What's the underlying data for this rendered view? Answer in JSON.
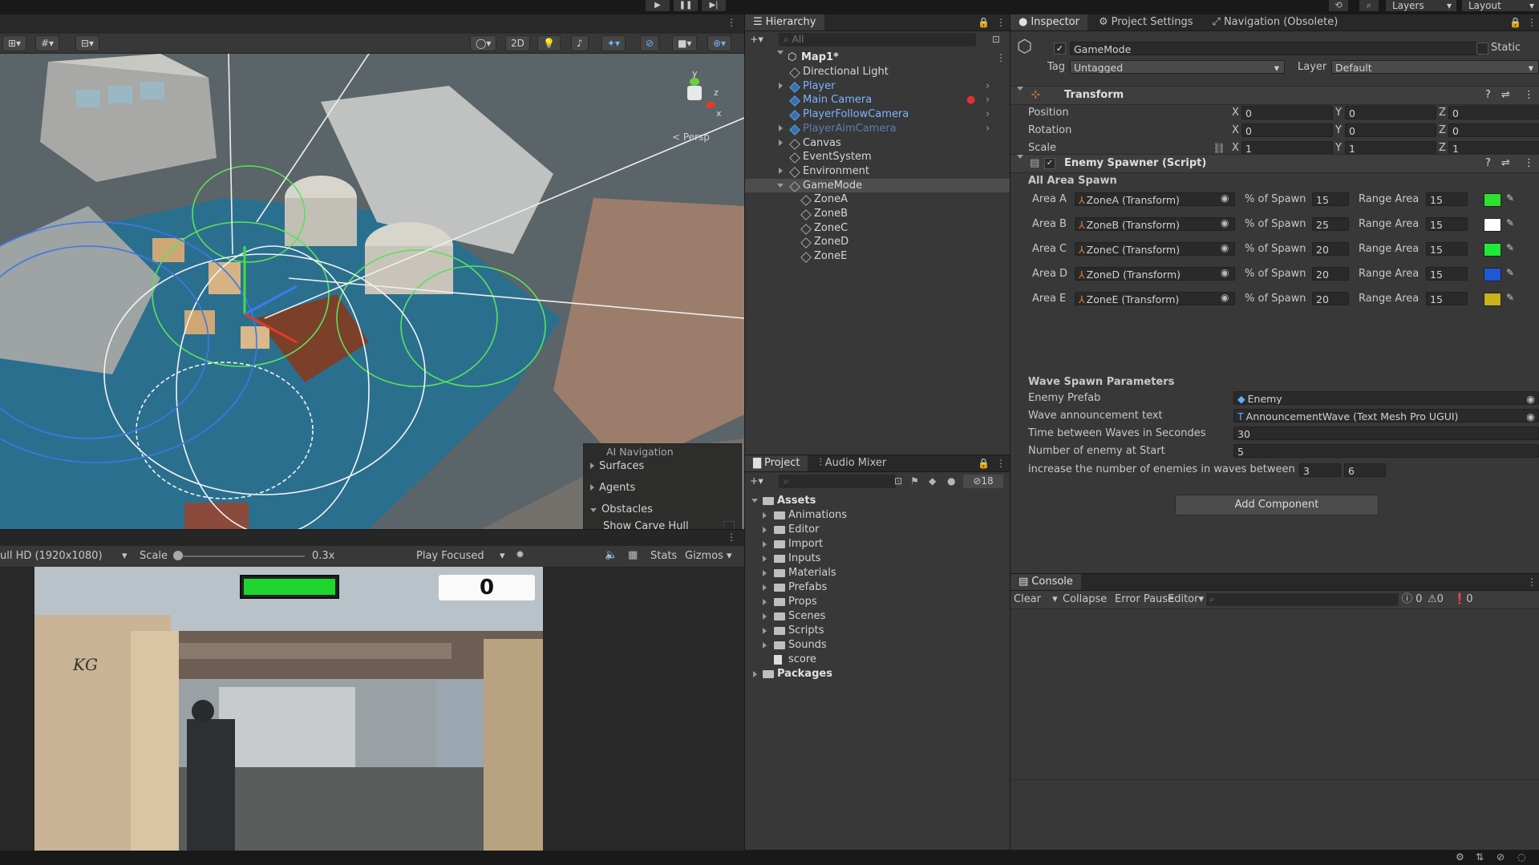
{
  "toolbar": {
    "layers_label": "Layers",
    "layout_label": "Layout"
  },
  "scene_view": {
    "mode_2d": "2D",
    "persp_label": "< Persp",
    "axis_y": "y",
    "axis_z": "z",
    "axis_x": "x",
    "ai_nav": {
      "title": "AI Navigation",
      "items": [
        "Surfaces",
        "Agents",
        "Obstacles"
      ],
      "show_carve_hull": "Show Carve Hull"
    }
  },
  "game_view": {
    "resolution": "ull HD (1920x1080)",
    "scale_label": "Scale",
    "scale_value": "0.3x",
    "play_focused": "Play Focused",
    "stats": "Stats",
    "gizmos": "Gizmos",
    "score": "0",
    "health_fraction": 1.0,
    "graffiti": "KG"
  },
  "hierarchy": {
    "tab": "Hierarchy",
    "search_placeholder": "All",
    "scene": "Map1*",
    "items": [
      {
        "label": "Directional Light",
        "depth": 1,
        "prefab": false,
        "arrow": "none"
      },
      {
        "label": "Player",
        "depth": 1,
        "prefab": true,
        "arrow": "right"
      },
      {
        "label": "Main Camera",
        "depth": 1,
        "prefab": true,
        "arrow": "none"
      },
      {
        "label": "PlayerFollowCamera",
        "depth": 1,
        "prefab": true,
        "arrow": "none"
      },
      {
        "label": "PlayerAimCamera",
        "depth": 1,
        "prefab": true,
        "arrow": "right",
        "disabled": true
      },
      {
        "label": "Canvas",
        "depth": 1,
        "prefab": false,
        "arrow": "right"
      },
      {
        "label": "EventSystem",
        "depth": 1,
        "prefab": false,
        "arrow": "none"
      },
      {
        "label": "Environment",
        "depth": 1,
        "prefab": false,
        "arrow": "right"
      },
      {
        "label": "GameMode",
        "depth": 1,
        "prefab": false,
        "arrow": "down",
        "selected": true
      },
      {
        "label": "ZoneA",
        "depth": 2,
        "prefab": false,
        "arrow": "none"
      },
      {
        "label": "ZoneB",
        "depth": 2,
        "prefab": false,
        "arrow": "none"
      },
      {
        "label": "ZoneC",
        "depth": 2,
        "prefab": false,
        "arrow": "none"
      },
      {
        "label": "ZoneD",
        "depth": 2,
        "prefab": false,
        "arrow": "none"
      },
      {
        "label": "ZoneE",
        "depth": 2,
        "prefab": false,
        "arrow": "none"
      }
    ]
  },
  "project": {
    "tabs": [
      "Project",
      "Audio Mixer"
    ],
    "hidden_count": "18",
    "root": "Assets",
    "folders": [
      "Animations",
      "Editor",
      "Import",
      "Inputs",
      "Materials",
      "Prefabs",
      "Props",
      "Scenes",
      "Scripts",
      "Sounds"
    ],
    "file": "score",
    "packages": "Packages"
  },
  "inspector": {
    "tabs": [
      "Inspector",
      "Project Settings",
      "Navigation (Obsolete)"
    ],
    "object_name": "GameMode",
    "static_label": "Static",
    "tag_label": "Tag",
    "tag_value": "Untagged",
    "layer_label": "Layer",
    "layer_value": "Default",
    "transform": {
      "title": "Transform",
      "rows": [
        {
          "label": "Position",
          "x": "0",
          "y": "0",
          "z": "0"
        },
        {
          "label": "Rotation",
          "x": "0",
          "y": "0",
          "z": "0"
        },
        {
          "label": "Scale",
          "x": "1",
          "y": "1",
          "z": "1"
        }
      ]
    },
    "spawner": {
      "title": "Enemy Spawner (Script)",
      "all_area_label": "All Area Spawn",
      "percent_label": "% of Spawn",
      "range_label": "Range Area",
      "areas": [
        {
          "label": "Area A",
          "target": "ZoneA (Transform)",
          "percent": "15",
          "range": "15",
          "color": "#2fe02f"
        },
        {
          "label": "Area B",
          "target": "ZoneB (Transform)",
          "percent": "25",
          "range": "15",
          "color": "#ffffff"
        },
        {
          "label": "Area C",
          "target": "ZoneC (Transform)",
          "percent": "20",
          "range": "15",
          "color": "#22e83a"
        },
        {
          "label": "Area D",
          "target": "ZoneD (Transform)",
          "percent": "20",
          "range": "15",
          "color": "#2157d6"
        },
        {
          "label": "Area E",
          "target": "ZoneE (Transform)",
          "percent": "20",
          "range": "15",
          "color": "#c9b21b"
        }
      ],
      "wave_title": "Wave Spawn Parameters",
      "params": [
        {
          "label": "Enemy Prefab",
          "value": "Enemy"
        },
        {
          "label": "Wave announcement text",
          "value": "AnnouncementWave (Text Mesh Pro UGUI)"
        },
        {
          "label": "Time between Waves in Secondes",
          "value": "30"
        },
        {
          "label": "Number of enemy at Start",
          "value": "5"
        }
      ],
      "increase_label": "increase the number of enemies in waves between",
      "increase_min": "3",
      "increase_max": "6"
    },
    "add_component": "Add Component"
  },
  "console": {
    "tab": "Console",
    "clear": "Clear",
    "collapse": "Collapse",
    "error_pause": "Error Pause",
    "editor": "Editor",
    "log_count": "0",
    "warn_count": "0",
    "error_count": "0"
  },
  "colors": {
    "selection": "#2c5d87",
    "prefab_blue": "#7cb4ff",
    "health_green": "#1fd62e"
  }
}
